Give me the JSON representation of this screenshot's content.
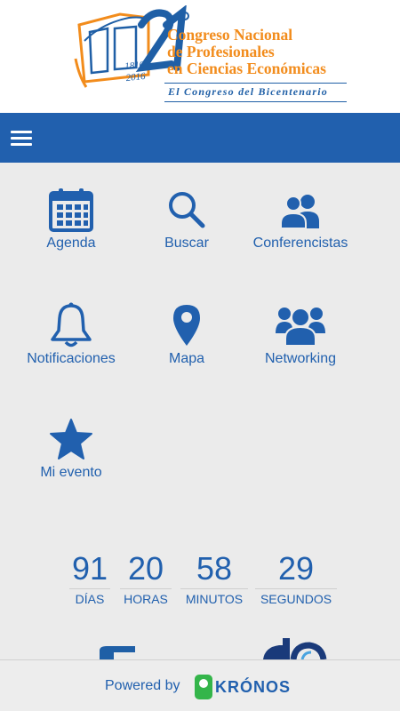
{
  "header": {
    "logo": {
      "big_number": "21°",
      "title_lines": [
        "Congreso Nacional",
        "de Profesionales",
        "en Ciencias Económicas"
      ],
      "tagline": "El Congreso del Bicentenario",
      "years": [
        "1816",
        "2016"
      ]
    }
  },
  "navbar": {
    "menu_icon": "hamburger-icon"
  },
  "menu": [
    {
      "label": "Agenda",
      "icon": "calendar-icon"
    },
    {
      "label": "Buscar",
      "icon": "search-icon"
    },
    {
      "label": "Conferencistas",
      "icon": "speakers-icon"
    },
    {
      "label": "Notificaciones",
      "icon": "bell-icon"
    },
    {
      "label": "Mapa",
      "icon": "map-pin-icon"
    },
    {
      "label": "Networking",
      "icon": "group-icon"
    },
    {
      "label": "Mi evento",
      "icon": "star-icon"
    }
  ],
  "countdown": [
    {
      "value": "91",
      "unit": "DÍAS"
    },
    {
      "value": "20",
      "unit": "HORAS"
    },
    {
      "value": "58",
      "unit": "MINUTOS"
    },
    {
      "value": "29",
      "unit": "SEGUNDOS"
    }
  ],
  "footer": {
    "powered_by": "Powered by",
    "brand": "KRÓNOS"
  },
  "colors": {
    "primary": "#2160ae",
    "accent": "#f28c1c",
    "brand_green": "#34b54a",
    "background": "#ebebeb"
  }
}
